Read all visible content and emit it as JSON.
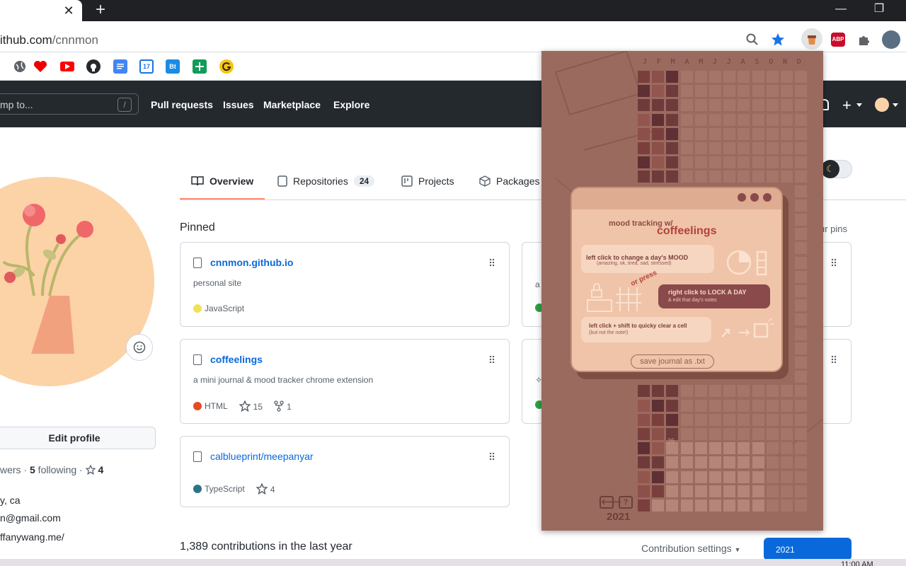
{
  "browser": {
    "tab_close": "✕",
    "new_tab": "+",
    "minimize": "—",
    "restore": "❐",
    "url_host": "ithub.com",
    "url_path": "/cnnmon",
    "abp_label": "ABP",
    "bookmark_labels": {
      "calendar": "17",
      "bt": "Bt"
    }
  },
  "github_header": {
    "search_placeholder": "mp to...",
    "search_shortcut": "/",
    "nav": [
      "Pull requests",
      "Issues",
      "Marketplace",
      "Explore"
    ],
    "plus": "+"
  },
  "profile": {
    "edit_profile": "Edit profile",
    "followers_suffix": "wers · ",
    "following_count": "5",
    "following_label": " following · ",
    "stars": "4",
    "location": "y, ca",
    "email": "n@gmail.com",
    "website": "ffanywang.me/"
  },
  "tabs": [
    {
      "label": "Overview"
    },
    {
      "label": "Repositories",
      "count": "24"
    },
    {
      "label": "Projects"
    },
    {
      "label": "Packages"
    }
  ],
  "pinned": {
    "title": "Pinned",
    "customize": "ur pins",
    "cards": [
      {
        "name": "cnnmon.github.io",
        "desc": "personal site",
        "lang": "JavaScript",
        "lang_color": "#f1e05a",
        "stars": "",
        "forks": ""
      },
      {
        "name": "coffeelings",
        "desc": "a mini journal & mood tracker chrome extension",
        "lang": "HTML",
        "lang_color": "#e34c26",
        "stars": "15",
        "forks": "1"
      },
      {
        "name": "calblueprint/meepanyar",
        "desc": "",
        "lang": "TypeScript",
        "lang_color": "#2b7489",
        "stars": "4",
        "forks": ""
      }
    ],
    "partial_fragments": [
      "a",
      "✧"
    ]
  },
  "contributions": {
    "summary": "1,389 contributions in the last year",
    "settings": "Contribution settings",
    "year": "2021"
  },
  "taskbar": {
    "clock": "11:00 AM"
  },
  "popup": {
    "months": [
      "J",
      "F",
      "M",
      "A",
      "M",
      "J",
      "J",
      "A",
      "S",
      "O",
      "N",
      "D"
    ],
    "cell_number": "26",
    "help_title_1": "mood tracking w/",
    "help_title_2": "coffeelings",
    "tip1_title": "left click to change a day's MOOD",
    "tip1_sub": "(amazing, ok, tired, sad, stressed)",
    "or_press": "or press",
    "tip2_title": "right click to LOCK A DAY",
    "tip2_sub": "& edit that day's notes",
    "tip3_title": "left click + shift to quicky clear a cell",
    "tip3_sub": "(but not the note!)",
    "save_button": "save journal as .txt",
    "back": "🡐",
    "help": "?",
    "year": "2021"
  }
}
